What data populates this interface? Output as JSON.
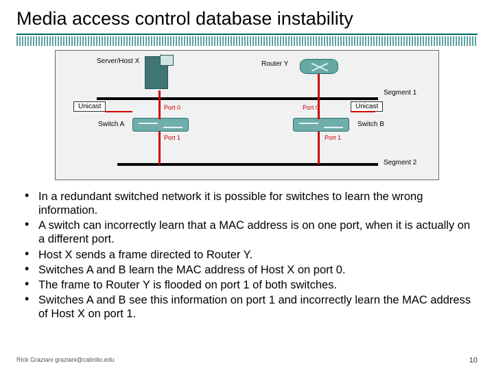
{
  "title": "Media access control database instability",
  "diagram": {
    "host_label": "Server/Host X",
    "router_label": "Router Y",
    "unicast_left": "Unicast",
    "unicast_right": "Unicast",
    "switch_a": "Switch A",
    "switch_b": "Switch B",
    "port0_a": "Port 0",
    "port1_a": "Port 1",
    "port0_b": "Port 0",
    "port1_b": "Port 1",
    "segment1": "Segment 1",
    "segment2": "Segment 2"
  },
  "bullets": [
    "In a redundant switched network it is possible for switches to learn the wrong information.",
    "A switch can incorrectly learn that a MAC address is on one port, when it is actually on a different port.",
    "Host X sends a frame directed to Router Y.",
    "Switches A and B learn the MAC address of Host X on port 0.",
    "The frame to Router Y is flooded on port 1 of both switches.",
    "Switches A and B see this information on port 1 and incorrectly learn the MAC address of Host X on port 1."
  ],
  "footer": {
    "author": "Rick Graziani  graziani@cabrillo.edu",
    "page": "10"
  }
}
